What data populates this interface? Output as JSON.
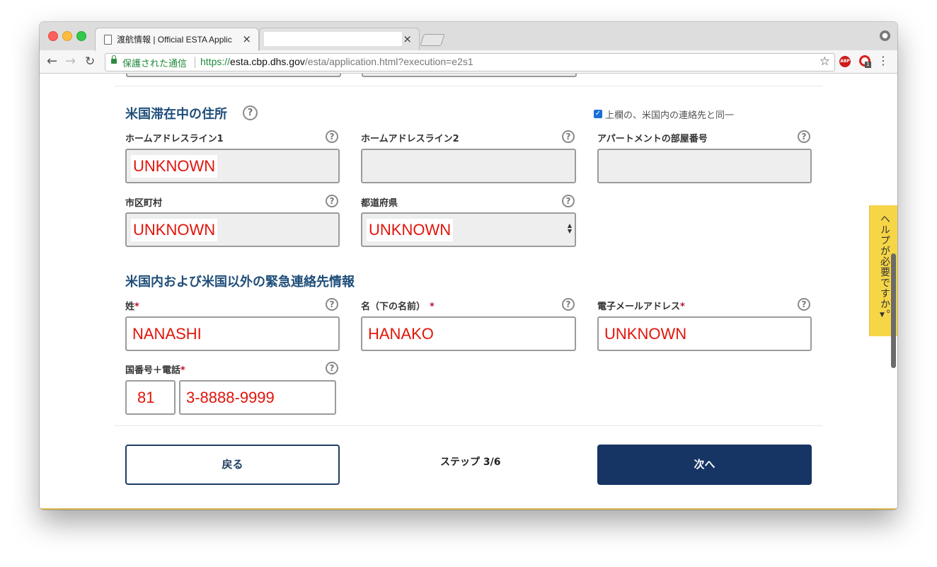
{
  "browser": {
    "tabs": [
      {
        "title": "渡航情報 | Official ESTA Applic",
        "close": "×"
      },
      {
        "title": "",
        "close": "×"
      }
    ],
    "address": {
      "secure_label": "保護された通信",
      "url_scheme": "https://",
      "url_host": "esta.cbp.dhs.gov",
      "url_path": "/esta/application.html?execution=e2s1"
    },
    "extensions": {
      "abp": "ABP",
      "badge_count": "1"
    }
  },
  "us_address_section": {
    "title": "米国滞在中の住所",
    "same_as_above": {
      "label": "上欄の、米国内の連絡先と同一",
      "checked": true
    },
    "fields": {
      "address_line1": {
        "label": "ホームアドレスライン1",
        "value": "UNKNOWN"
      },
      "address_line2": {
        "label": "ホームアドレスライン2",
        "value": ""
      },
      "apartment": {
        "label": "アパートメントの部屋番号",
        "value": ""
      },
      "city": {
        "label": "市区町村",
        "value": "UNKNOWN"
      },
      "state": {
        "label": "都道府県",
        "value": "UNKNOWN"
      }
    }
  },
  "emergency_section": {
    "title": "米国内および米国以外の緊急連絡先情報",
    "fields": {
      "last_name": {
        "label": "姓",
        "value": "NANASHI"
      },
      "first_name": {
        "label": "名（下の名前）",
        "value": "HANAKO"
      },
      "email": {
        "label": "電子メールアドレス",
        "value": "UNKNOWN"
      },
      "phone": {
        "label": "国番号＋電話",
        "country_code": "81",
        "number": "3-8888-9999"
      }
    },
    "required_marker": "*"
  },
  "footer": {
    "back_label": "戻る",
    "step_text": "ステップ 3/6",
    "next_label": "次へ"
  },
  "help_tab": {
    "label": "ヘルプが必要ですか。",
    "arrow": "▼"
  },
  "help_icon_glyph": "?",
  "colors": {
    "section_title": "#1f4e7a",
    "input_value": "#e1140a",
    "primary_button": "#163464",
    "help_tab": "#f6d547",
    "required": "#c0112b"
  }
}
